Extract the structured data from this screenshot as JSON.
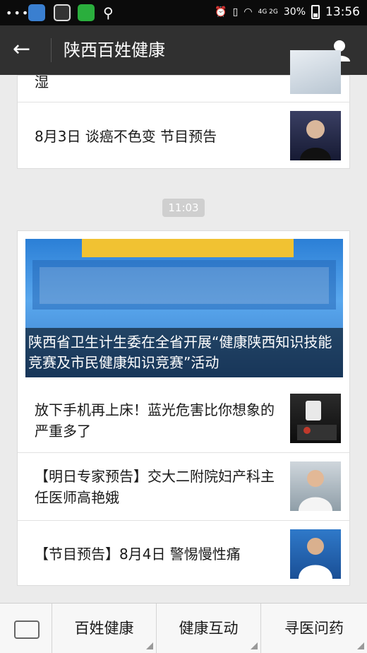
{
  "status_bar": {
    "time": "13:56",
    "battery": "30%",
    "network": "4G 2G"
  },
  "nav": {
    "title": "陕西百姓健康"
  },
  "group1": {
    "partial_item": {
      "title": "湿"
    },
    "item": {
      "title": "8月3日 谈癌不色变 节目预告"
    }
  },
  "timestamp": "11:03",
  "group2": {
    "banner": {
      "caption": "陕西省卫生计生委在全省开展“健康陕西知识技能竞赛及市民健康知识竞赛”活动"
    },
    "items": [
      {
        "title": "放下手机再上床！蓝光危害比你想象的严重多了"
      },
      {
        "title": "【明日专家预告】交大二附院妇产科主任医师高艳娥"
      },
      {
        "title": "【节目预告】8月4日 警惕慢性痛"
      }
    ]
  },
  "menu": {
    "items": [
      "百姓健康",
      "健康互动",
      "寻医问药"
    ]
  }
}
